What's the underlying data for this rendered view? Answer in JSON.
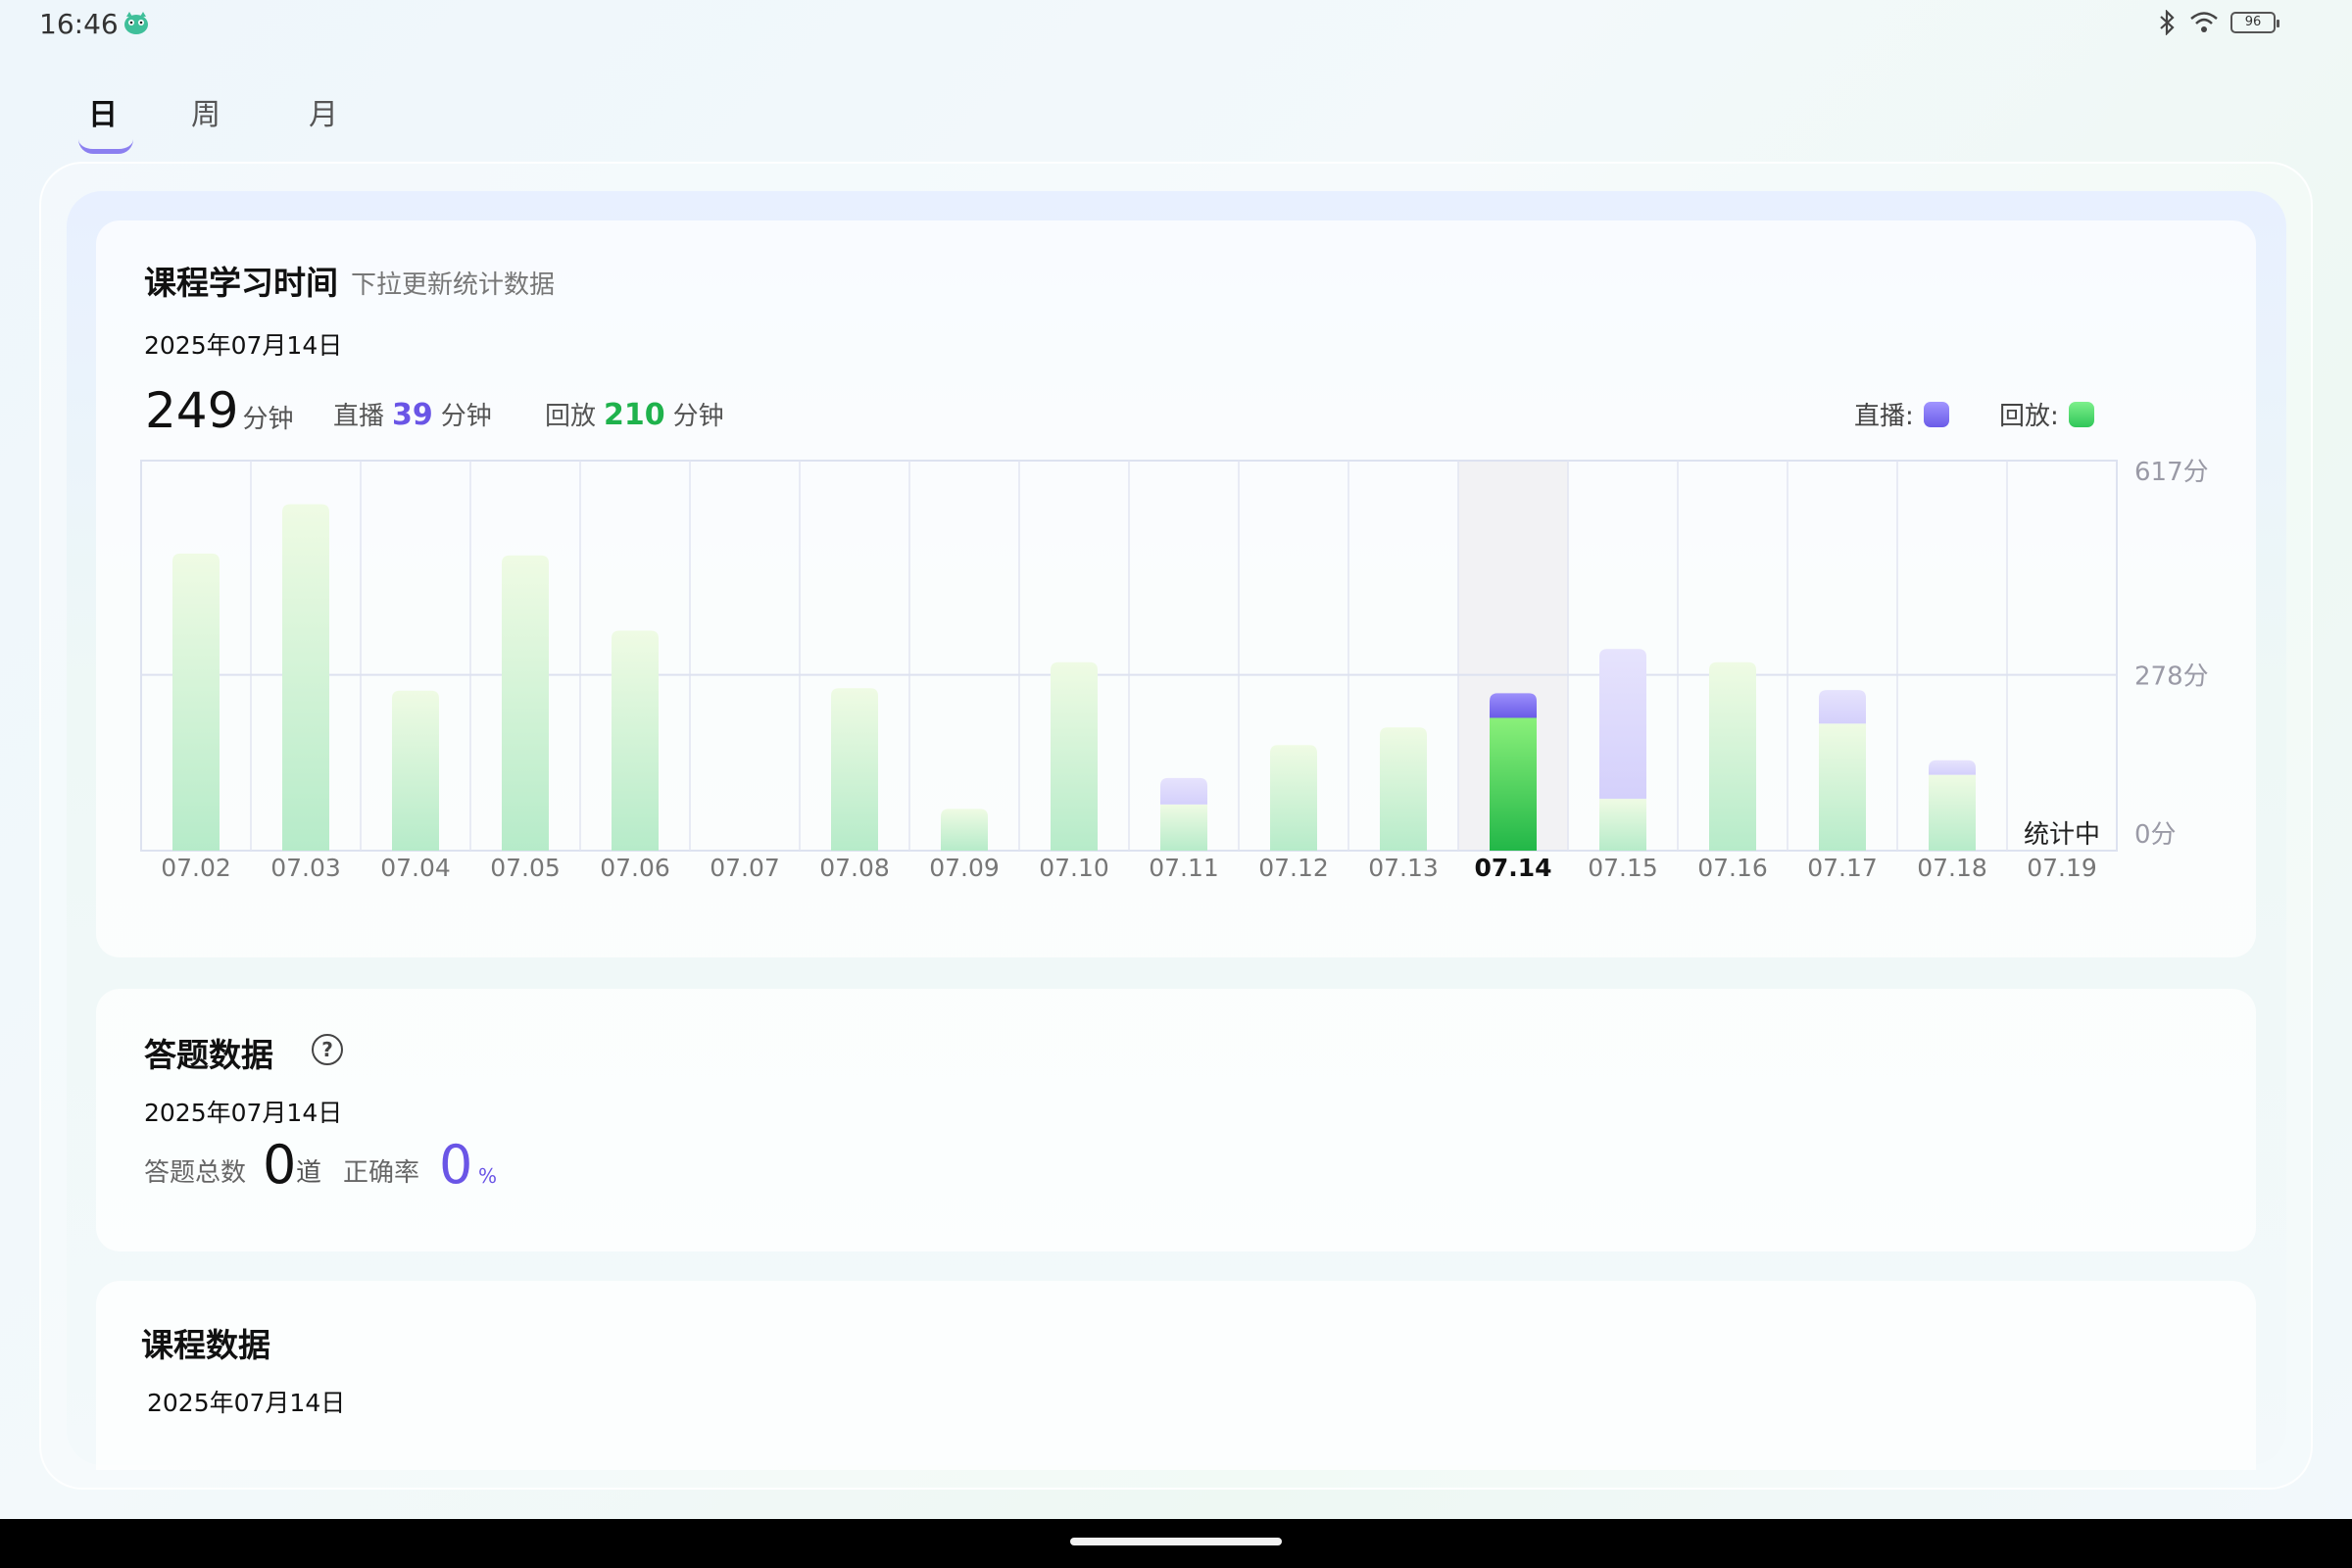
{
  "status_bar": {
    "time": "16:46",
    "battery": "96"
  },
  "tabs": [
    {
      "label": "日",
      "active": true
    },
    {
      "label": "周",
      "active": false
    },
    {
      "label": "月",
      "active": false
    }
  ],
  "study_card": {
    "title": "课程学习时间",
    "subtitle": "下拉更新统计数据",
    "date": "2025年07月14日",
    "total_value": "249",
    "total_unit": "分钟",
    "live_label": "直播",
    "live_value": "39",
    "live_unit": "分钟",
    "replay_label": "回放",
    "replay_value": "210",
    "replay_unit": "分钟",
    "legend_live": "直播:",
    "legend_replay": "回放:",
    "colors": {
      "live": "#7b6cf0",
      "replay": "#3ccf63"
    }
  },
  "chart_data": {
    "type": "bar",
    "stacked": true,
    "categories": [
      "07.02",
      "07.03",
      "07.04",
      "07.05",
      "07.06",
      "07.07",
      "07.08",
      "07.09",
      "07.10",
      "07.11",
      "07.12",
      "07.13",
      "07.14",
      "07.15",
      "07.16",
      "07.17",
      "07.18",
      "07.19"
    ],
    "series": [
      {
        "name": "回放",
        "values": [
          470,
          548,
          253,
          467,
          348,
          0,
          257,
          66,
          298,
          73,
          167,
          195,
          210,
          82,
          298,
          201,
          120,
          0
        ]
      },
      {
        "name": "直播",
        "values": [
          0,
          0,
          0,
          0,
          0,
          0,
          0,
          0,
          0,
          42,
          0,
          0,
          39,
          237,
          0,
          53,
          23,
          0
        ]
      }
    ],
    "y_ticks": [
      "617分",
      "278分",
      "0分"
    ],
    "ylim": [
      0,
      617
    ],
    "selected_category": "07.14",
    "pending_label": "统计中",
    "grid": true
  },
  "answer_card": {
    "title": "答题数据",
    "date": "2025年07月14日",
    "total_label": "答题总数",
    "total_value": "0",
    "total_unit": "道",
    "accuracy_label": "正确率",
    "accuracy_value": "0",
    "accuracy_unit": "%"
  },
  "course_card": {
    "title": "课程数据",
    "date": "2025年07月14日"
  }
}
